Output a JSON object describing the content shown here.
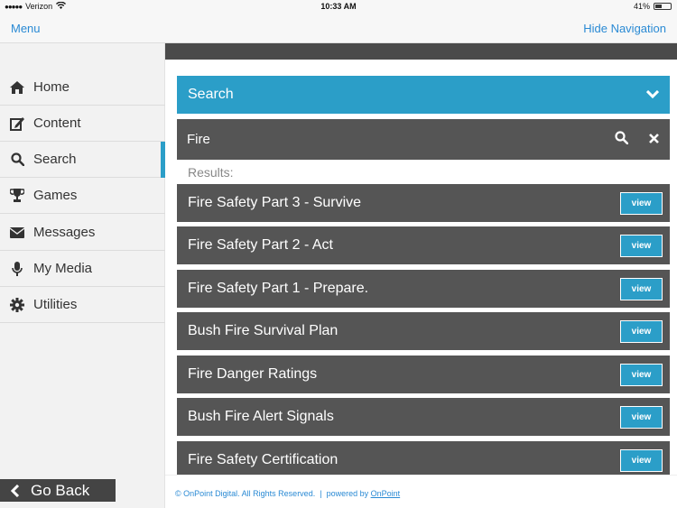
{
  "status_bar": {
    "carrier": "Verizon",
    "time": "10:33 AM",
    "battery": "41%"
  },
  "nav_bar": {
    "menu_label": "Menu",
    "hide_nav_label": "Hide Navigation"
  },
  "sidebar": {
    "items": [
      {
        "label": "Home",
        "icon": "home-icon"
      },
      {
        "label": "Content",
        "icon": "edit-icon"
      },
      {
        "label": "Search",
        "icon": "search-icon"
      },
      {
        "label": "Games",
        "icon": "trophy-icon"
      },
      {
        "label": "Messages",
        "icon": "envelope-icon"
      },
      {
        "label": "My Media",
        "icon": "microphone-icon"
      },
      {
        "label": "Utilities",
        "icon": "gear-icon"
      }
    ],
    "active": "Search",
    "go_back_label": "Go Back"
  },
  "search": {
    "header_label": "Search",
    "query": "Fire",
    "results_label": "Results:"
  },
  "results": [
    {
      "title": "Fire Safety Part 3 - Survive",
      "button": "view"
    },
    {
      "title": "Fire Safety Part 2 - Act",
      "button": "view"
    },
    {
      "title": "Fire Safety Part 1 - Prepare.",
      "button": "view"
    },
    {
      "title": "Bush Fire Survival Plan",
      "button": "view"
    },
    {
      "title": "Fire Danger Ratings",
      "button": "view"
    },
    {
      "title": "Bush Fire Alert Signals",
      "button": "view"
    },
    {
      "title": "Fire Safety Certification",
      "button": "view"
    }
  ],
  "footer": {
    "copyright": "© OnPoint Digital. All Rights Reserved.",
    "separator": "|",
    "powered_prefix": "powered by",
    "powered_link": "OnPoint"
  },
  "colors": {
    "accent": "#2b9ec8",
    "row_background": "#555555",
    "link": "#2a8ad4"
  }
}
